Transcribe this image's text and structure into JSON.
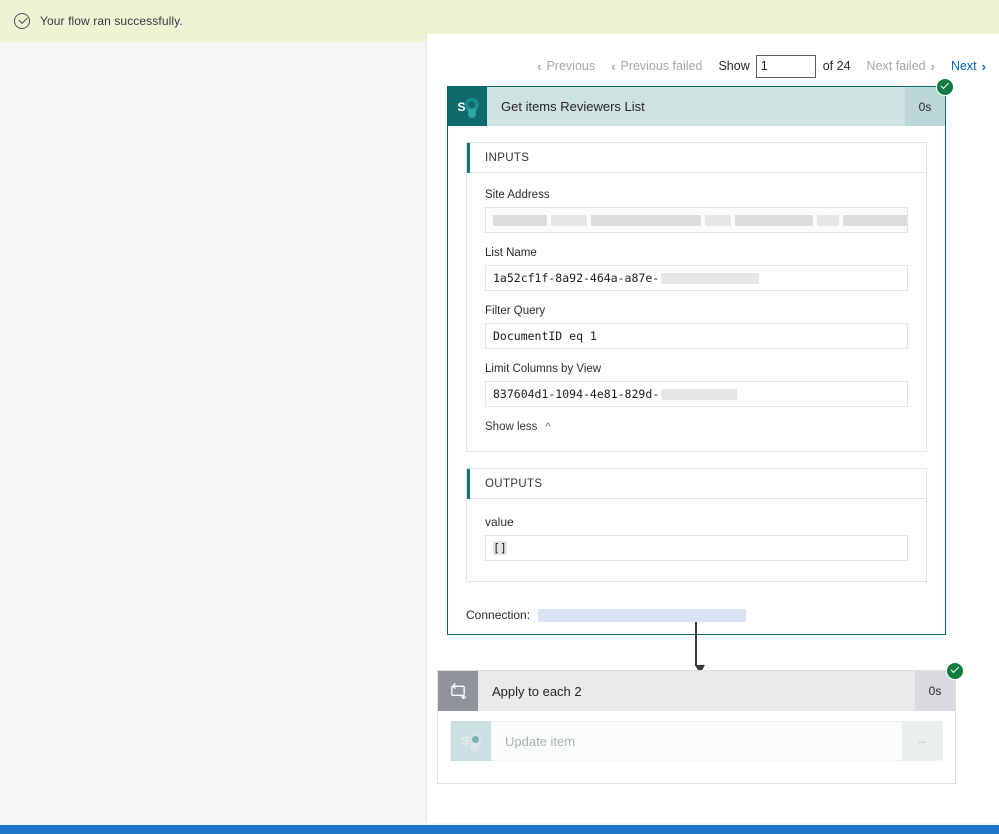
{
  "banner": {
    "icon": "check-circle-icon",
    "message": "Your flow ran successfully."
  },
  "pager": {
    "previous_label": "Previous",
    "previous_failed_label": "Previous failed",
    "show_label": "Show",
    "show_value": "1",
    "show_placeholder": "1",
    "of_label": "of 24",
    "total_runs": 24,
    "next_failed_label": "Next failed",
    "next_label": "Next",
    "chevron_left": "‹",
    "chevron_right": "›",
    "disabled_color": "#a6a6a6",
    "enabled_color": "#0164bb"
  },
  "action_card": {
    "icon": "sharepoint-icon",
    "title": "Get items Reviewers List",
    "duration": "0s",
    "status": "succeeded",
    "status_icon": "green-check-badge-icon",
    "accent_color": "#0b6a6a",
    "header_bg": "#cfe2e2",
    "inputs": {
      "section_title": "INPUTS",
      "fields": [
        {
          "label": "Site Address",
          "value": "",
          "redacted": true,
          "mono": false
        },
        {
          "label": "List Name",
          "value": "1a52cf1f-8a92-464a-a87e-",
          "redacted": true,
          "mono": true
        },
        {
          "label": "Filter Query",
          "value": "DocumentID eq 1",
          "redacted": false,
          "mono": true
        },
        {
          "label": "Limit Columns by View",
          "value": "837604d1-1094-4e81-829d-",
          "redacted": true,
          "mono": true
        }
      ],
      "show_less_label": "Show less",
      "show_less_icon": "chevron-up-icon"
    },
    "outputs": {
      "section_title": "OUTPUTS",
      "fields": [
        {
          "label": "value",
          "value": "[]"
        }
      ]
    },
    "connection": {
      "label": "Connection:",
      "value": "",
      "redacted": true
    }
  },
  "connector": {
    "icon": "down-arrow-icon"
  },
  "scope_card": {
    "icon": "loop-icon",
    "title": "Apply to each 2",
    "duration": "0s",
    "status": "succeeded",
    "status_icon": "green-check-badge-icon",
    "children": [
      {
        "icon": "sharepoint-icon",
        "title": "Update item",
        "duration": "--",
        "status": "skipped"
      }
    ]
  }
}
